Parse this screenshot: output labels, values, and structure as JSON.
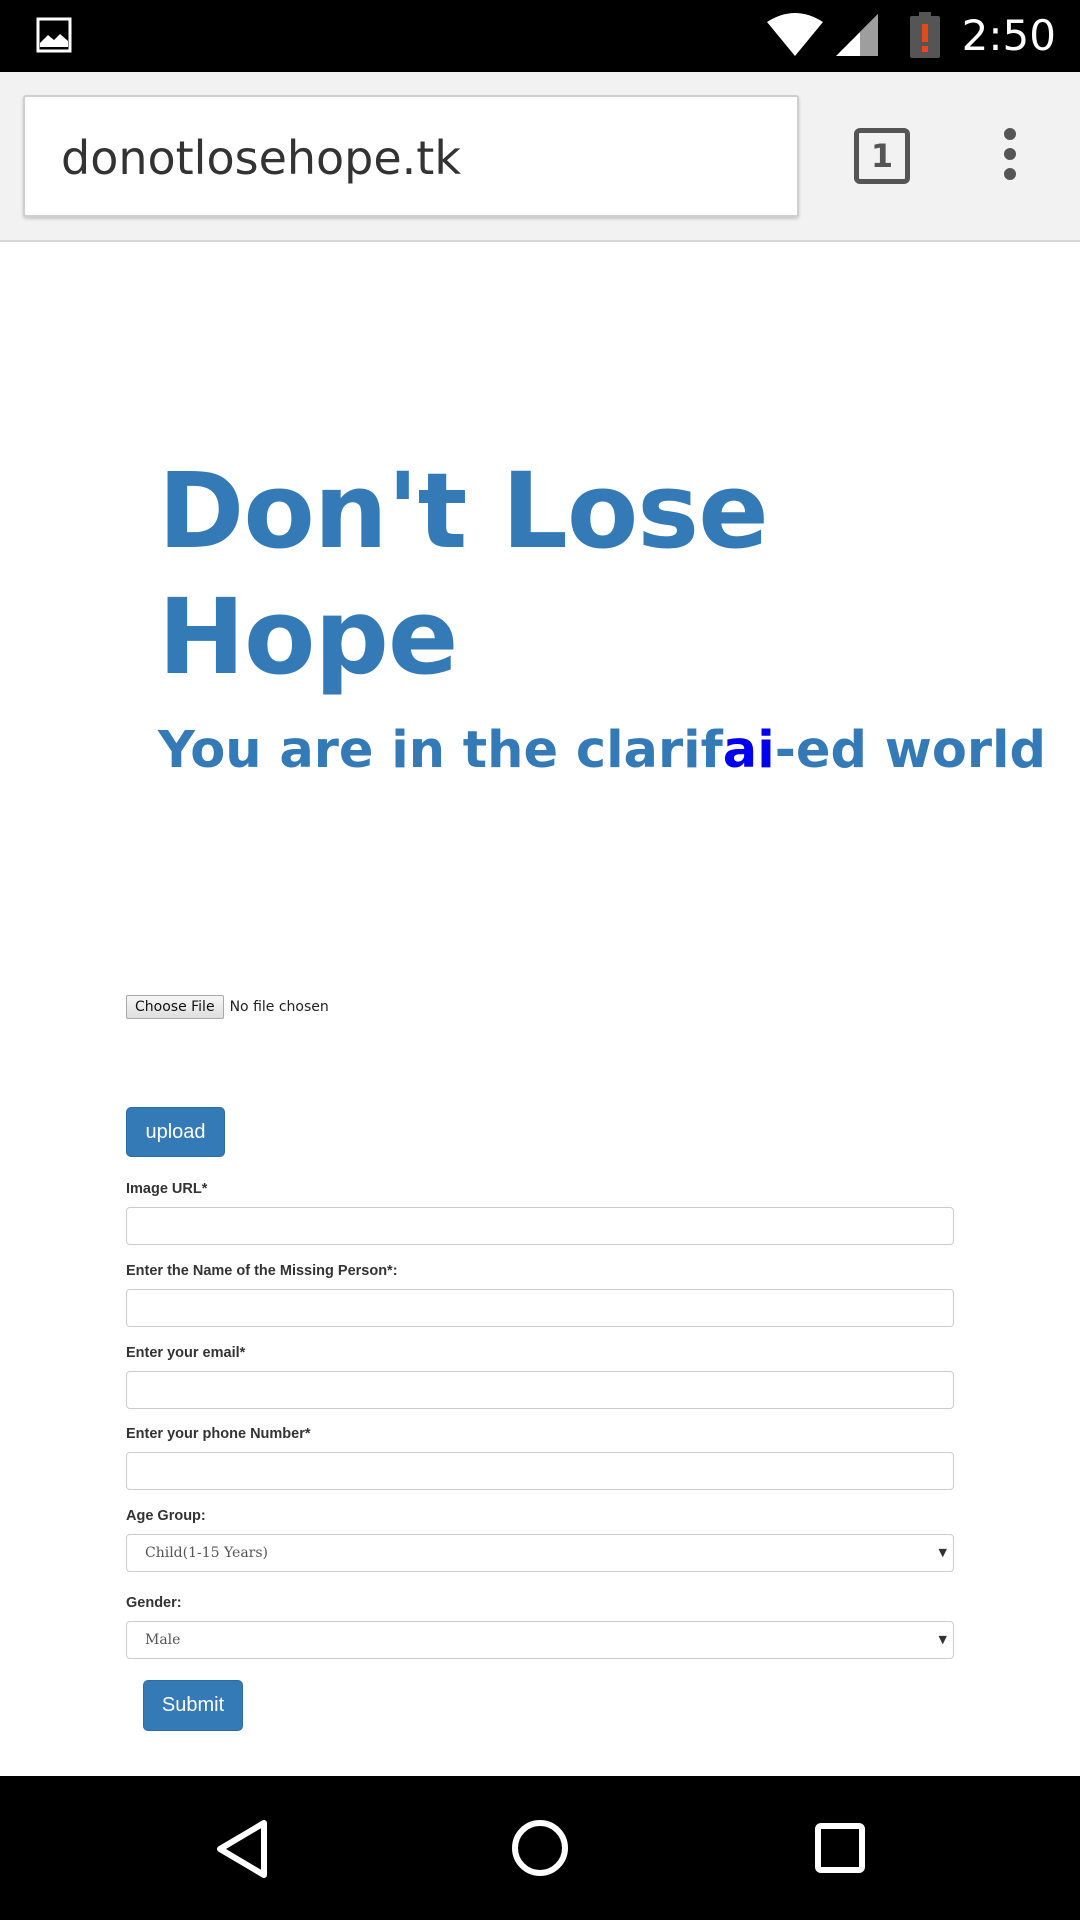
{
  "status_bar": {
    "time": "2:50",
    "icons": [
      "gallery-icon",
      "wifi-icon",
      "cell-signal-icon",
      "battery-alert-icon"
    ]
  },
  "browser": {
    "url": "donotlosehope.tk",
    "tab_count": "1",
    "icons": [
      "tab-switcher-icon",
      "overflow-menu-icon"
    ]
  },
  "hero": {
    "title": "Don't Lose Hope",
    "subtitle_prefix": "You are in the ",
    "subtitle_bold": "clarif",
    "subtitle_highlight": "ai",
    "subtitle_suffix": "-ed world",
    "colors": {
      "title": "#337ab7",
      "highlight": "#0000ee"
    }
  },
  "file_input": {
    "button_label": "Choose File",
    "status": "No file chosen"
  },
  "form": {
    "upload_label": "upload",
    "image_url_label": "Image URL*",
    "missing_name_label": "Enter the Name of the Missing Person*:",
    "email_label": "Enter your email*",
    "phone_label": "Enter your phone Number*",
    "age_group_label": "Age Group:",
    "age_group_value": "Child(1-15 Years)",
    "gender_label": "Gender:",
    "gender_value": "Male",
    "submit_label": "Submit",
    "accent_color": "#337ab7"
  },
  "nav_bar": {
    "icons": [
      "back-icon",
      "home-icon",
      "recents-icon"
    ]
  }
}
